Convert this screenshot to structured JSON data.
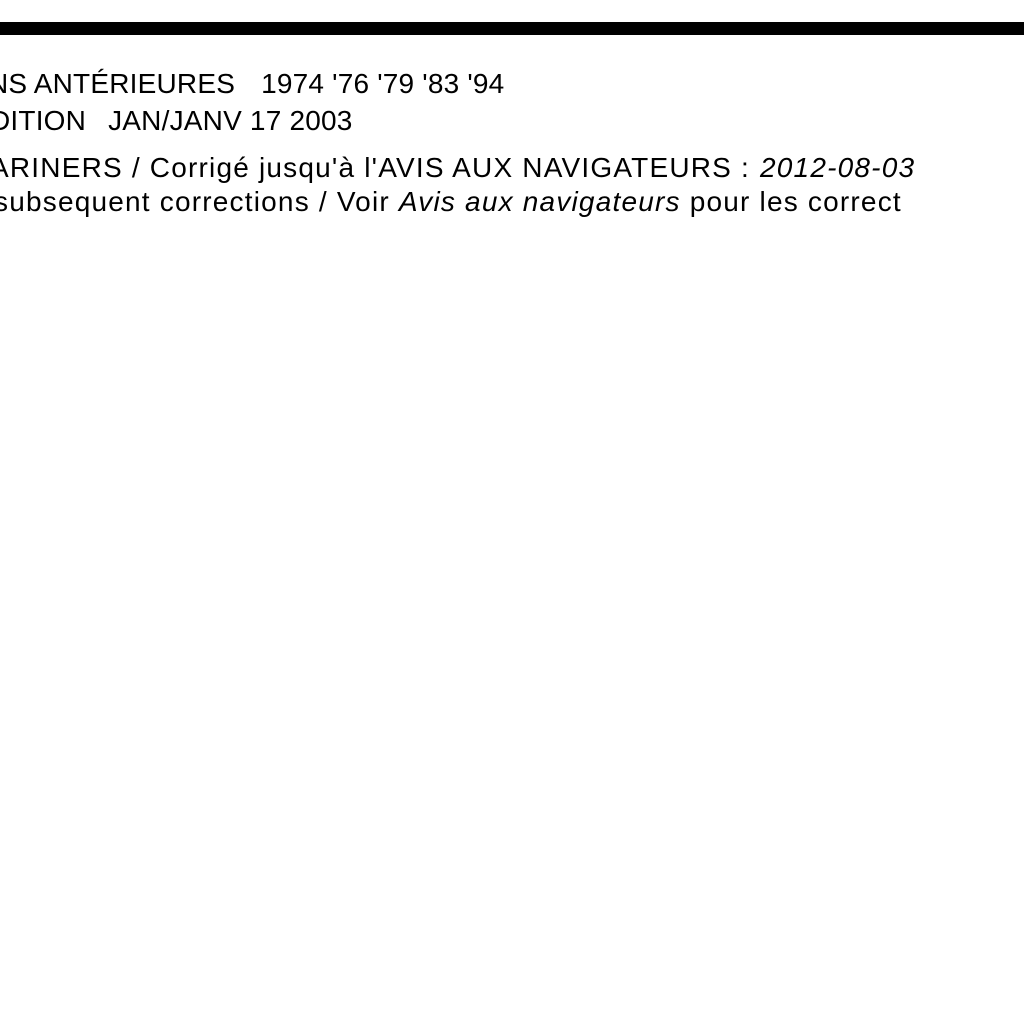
{
  "header": {
    "previous_editions_label": "NS ANTÉRIEURES",
    "previous_editions_years": "1974 '76 '79 '83 '94",
    "edition_label": "DITION",
    "edition_date": "JAN/JANV 17 2003"
  },
  "corrections": {
    "line1_prefix": "ARINERS / Corrigé jusqu'à l'AVIS AUX NAVIGATEURS :",
    "line1_date": "2012-08-03",
    "line2_prefix": "subsequent corrections / Voir",
    "line2_italic": "Avis aux navigateurs",
    "line2_suffix": "pour les correct"
  },
  "colors": {
    "text": "#000000",
    "rule": "#000000",
    "background": "#ffffff"
  }
}
